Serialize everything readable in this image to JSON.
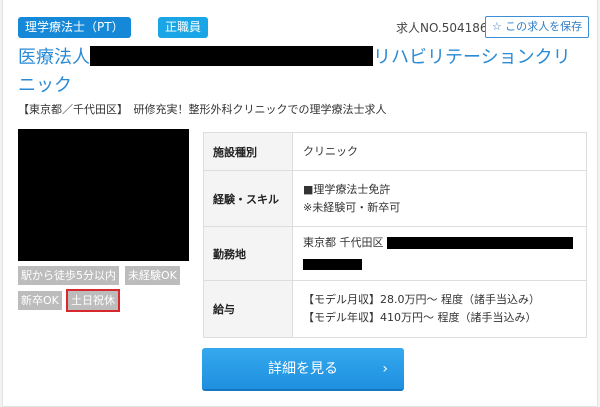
{
  "header": {
    "badge_profession": "理学療法士（PT）",
    "badge_employment": "正職員",
    "job_number": "求人NO.504186",
    "save_label": "☆ この求人を保存"
  },
  "title": {
    "prefix": "医療法人",
    "suffix": "リハビリテーションクリニック"
  },
  "subtitle": "【東京都／千代田区】　研修充実！整形外科クリニックでの理学療法士求人",
  "tags": [
    "駅から徒歩5分以内",
    "未経験OK",
    "新卒OK",
    "土日祝休"
  ],
  "table": {
    "facility_label": "施設種別",
    "facility_value": "クリニック",
    "skill_label": "経験・スキル",
    "skill_line1": "■理学療法士免許",
    "skill_line2": "※未経験可・新卒可",
    "location_label": "勤務地",
    "location_value": "東京都 千代田区",
    "salary_label": "給与",
    "salary_line1": "【モデル月収】28.0万円～ 程度（諸手当込み）",
    "salary_line2": "【モデル年収】410万円～ 程度（諸手当込み）"
  },
  "detail_button": {
    "label": "詳細を見る",
    "chevron": "›"
  }
}
